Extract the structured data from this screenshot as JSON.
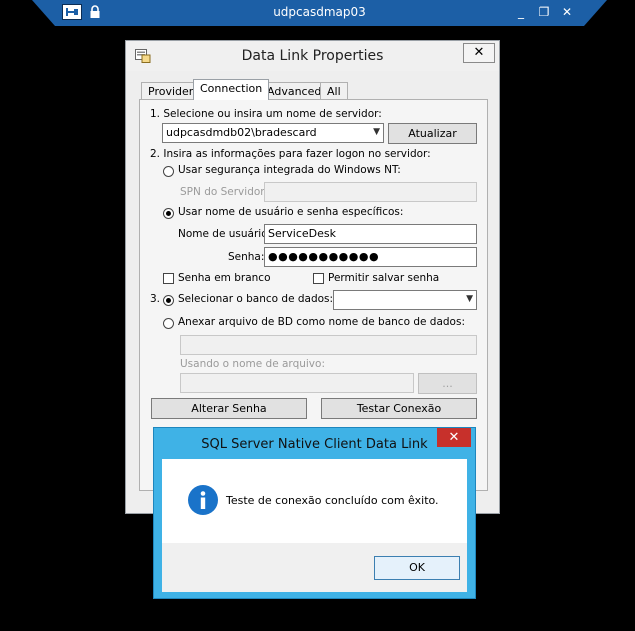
{
  "rdp_bar": {
    "title": "udpcasdmap03",
    "pin_icon": "pin-icon",
    "lock_icon": "lock-icon",
    "minimize": "_",
    "restore": "❐",
    "close": "✕"
  },
  "dialog": {
    "title": "Data Link Properties",
    "close_label": "✕",
    "tabs": [
      {
        "label": "Provider",
        "active": false
      },
      {
        "label": "Connection",
        "active": true
      },
      {
        "label": "Advanced",
        "active": false
      },
      {
        "label": "All",
        "active": false
      }
    ],
    "step1_label": "1. Selecione ou insira um nome de servidor:",
    "server_value": "udpcasdmdb02\\bradescard",
    "refresh_button": "Atualizar",
    "step2_label": "2. Insira as informações para fazer logon no servidor:",
    "radio_integrated": "Usar segurança integrada do Windows NT:",
    "spn_label": "SPN do Servidor:",
    "spn_value": "",
    "radio_specific": "Usar nome de usuário e senha específicos:",
    "username_label": "Nome de usuário:",
    "username_value": "ServiceDesk",
    "password_label": "Senha:",
    "password_value": "●●●●●●●●●●●",
    "blank_password": "Senha em branco",
    "allow_save": "Permitir salvar senha",
    "step3_prefix": "3.",
    "radio_select_db": "Selecionar o banco de dados:",
    "database_value": "",
    "radio_attach": "Anexar arquivo de BD como nome de banco de dados:",
    "attach_value": "",
    "filename_label": "Usando o nome de arquivo:",
    "filename_value": "",
    "browse_button": "...",
    "change_password_button": "Alterar Senha",
    "test_connection_button": "Testar Conexão"
  },
  "message_box": {
    "title": "SQL Server Native Client Data Link",
    "close_label": "✕",
    "icon": "info-icon",
    "text": "Teste de conexão concluído com êxito.",
    "ok_button": "OK"
  },
  "colors": {
    "rdp_bar": "#1c5fa6",
    "msg_frame": "#3fb2e6",
    "msg_close": "#c7302b",
    "info_icon": "#1a73c9"
  }
}
